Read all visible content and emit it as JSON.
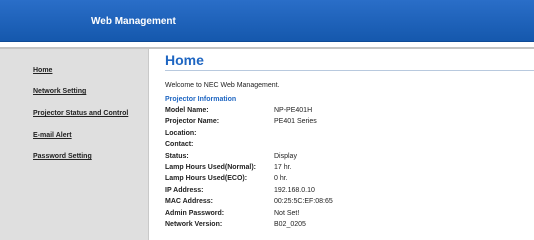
{
  "header": {
    "title": "Web Management"
  },
  "sidebar": {
    "items": [
      {
        "label": "Home"
      },
      {
        "label": "Network Setting"
      },
      {
        "label": "Projector Status and Control"
      },
      {
        "label": "E-mail Alert"
      },
      {
        "label": "Password Setting"
      }
    ]
  },
  "main": {
    "title": "Home",
    "welcome": "Welcome to NEC Web Management.",
    "section_title": "Projector Information",
    "info": [
      {
        "label": "Model Name:",
        "value": "NP-PE401H"
      },
      {
        "label": "Projector Name:",
        "value": "PE401 Series"
      },
      {
        "label": "Location:",
        "value": ""
      },
      {
        "label": "Contact:",
        "value": ""
      },
      {
        "label": "Status:",
        "value": "Display"
      },
      {
        "label": "Lamp Hours Used(Normal):",
        "value": "17 hr."
      },
      {
        "label": "Lamp Hours Used(ECO):",
        "value": "0 hr."
      },
      {
        "label": "IP Address:",
        "value": "192.168.0.10"
      },
      {
        "label": "MAC Address:",
        "value": "00:25:5C:EF:08:65"
      },
      {
        "label": "Admin Password:",
        "value": "Not Set!"
      },
      {
        "label": "Network Version:",
        "value": "B02_0205"
      }
    ]
  }
}
